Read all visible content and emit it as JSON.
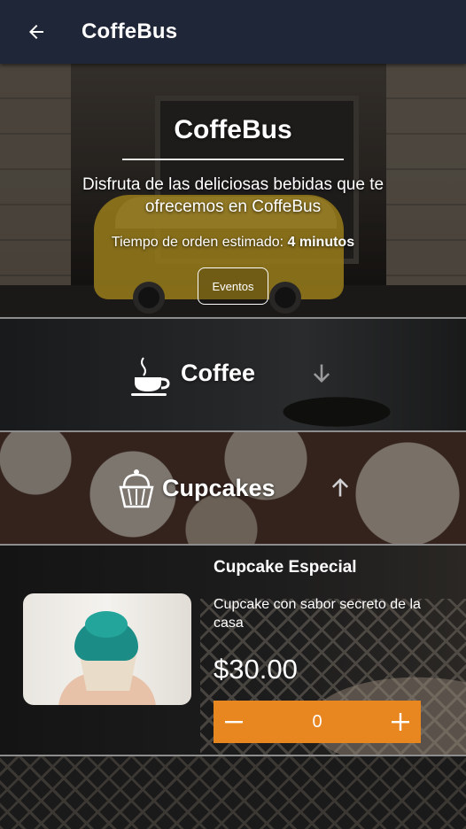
{
  "appbar": {
    "title": "CoffeBus",
    "back_icon": "arrow-left-icon"
  },
  "hero": {
    "title": "CoffeBus",
    "description": "Disfruta de las deliciosas bebidas que te ofrecemos en CoffeBus",
    "time_label": "Tiempo de orden estimado:",
    "time_value": "4 minutos",
    "events_button": "Eventos"
  },
  "categories": [
    {
      "label": "Coffee",
      "icon": "coffee-cup-icon",
      "arrow": "arrow-down-icon"
    },
    {
      "label": "Cupcakes",
      "icon": "cupcake-icon",
      "arrow": "arrow-up-icon"
    }
  ],
  "product": {
    "name": "Cupcake Especial",
    "description": "Cupcake con sabor secreto de la casa",
    "price": "$30.00",
    "quantity": "0",
    "stepper_color": "#e8861f"
  },
  "colors": {
    "appbar": "#1f2637",
    "accent": "#e8861f"
  }
}
